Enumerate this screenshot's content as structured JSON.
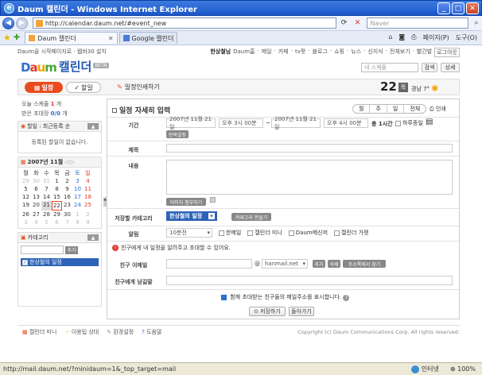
{
  "window": {
    "title": "Daum 캘린더 - Windows Internet Explorer",
    "url": "http://calendar.daum.net/#event_new",
    "search_placeholder": "Naver",
    "tabs": [
      {
        "label": "Daum 캘린더"
      },
      {
        "label": "Google 캘린더"
      }
    ],
    "commands": [
      "페이지(P)",
      "도구(O)"
    ],
    "status_url": "http://mail.daum.net/?minidaum=1&_top_target=mail",
    "status_zone": "인터넷",
    "zoom": "100%"
  },
  "page": {
    "topline_left": "Daum을 시작페이지로 · 웹바30 설치",
    "topline_user": "한상철님",
    "topline_links": [
      "Daum홈",
      "메일",
      "카페",
      "tv팟",
      "블로그",
      "쇼핑",
      "뉴스",
      "신지식",
      "전체보기",
      "빨간발"
    ],
    "logout": "로그아웃",
    "logo": {
      "d": "D",
      "a": "a",
      "u": "u",
      "m": "m",
      "calendar": "캘린더",
      "beta": "BETA"
    },
    "search_placeholder": "내 스케쥴",
    "search_btn": "검색",
    "detail_btn": "상세",
    "nav": {
      "schedule": "일정",
      "todo": "할일",
      "print": "일정인쇄하기",
      "date": "22",
      "weekday": "목",
      "weather": "경남 7°"
    },
    "sidebar": {
      "today_prefix": "오늘 스케쥴",
      "today_count": "1",
      "today_suffix": "개",
      "invites_prefix": "받은 초대장",
      "invites_count": "0/0",
      "invites_suffix": "개",
      "todo_head": "할일 : 최근등록 순",
      "todo_empty": "등록된 할일이 없습니다.",
      "cal_head": "2007년 11월",
      "weekdays": [
        "월",
        "화",
        "수",
        "목",
        "금",
        "토",
        "일"
      ],
      "weeks": [
        [
          "29",
          "30",
          "31",
          "1",
          "2",
          "3",
          "4"
        ],
        [
          "5",
          "6",
          "7",
          "8",
          "9",
          "10",
          "11"
        ],
        [
          "12",
          "13",
          "14",
          "15",
          "16",
          "17",
          "18"
        ],
        [
          "19",
          "20",
          "21",
          "22",
          "23",
          "24",
          "25"
        ],
        [
          "26",
          "27",
          "28",
          "29",
          "30",
          "1",
          "2"
        ],
        [
          "3",
          "4",
          "5",
          "6",
          "7",
          "8",
          "9"
        ]
      ],
      "cat_head": "카테고리",
      "cat_add": "추가",
      "cat_item": "한상철의 일정"
    },
    "form": {
      "title": "일정 자세히 입력",
      "views": [
        "월",
        "주",
        "일",
        "전체"
      ],
      "print": "인쇄",
      "period_label": "기간",
      "start_date": "2007년 11월 21일",
      "start_time": "오후 3시 00분",
      "tilde": "~",
      "end_date": "2007년 11월 21일",
      "end_time": "오후 4시 00분",
      "duration": "총 1시간",
      "allday": "하루종일",
      "repeat_btn": "반복설정",
      "subject_label": "제목",
      "content_label": "내용",
      "image_btn": "이미지 첨부하기",
      "category_label": "저장할 카테고리",
      "category_value": "한상철의 일정",
      "category_make": "카테고리 만들기",
      "alarm_label": "알림",
      "alarm_value": "10분전",
      "alarm_options": [
        "한메일",
        "캘린더 미니",
        "Daum메신저",
        "캘린더 가젯"
      ],
      "invite_msg": "친구에게 내 일정을 알려주고 초대할 수 있어요.",
      "email_label": "친구 이메일",
      "at": "@",
      "domain": "hanmail.net",
      "email_add": "추가",
      "email_del": "삭제",
      "addrbook": "주소록에서 찾기",
      "msg_label": "친구에게 남길말",
      "show_addr": "함께 초대받는 친구들의 메일주소를 표시합니다.",
      "save": "저장하기",
      "back": "돌아가기"
    },
    "footer": {
      "links": [
        "캘린더 미니",
        "이용팁 상대",
        "환경설정",
        "도움말"
      ],
      "copyright": "Copyright (c) Daum Communications Corp. All rights reserved."
    }
  }
}
